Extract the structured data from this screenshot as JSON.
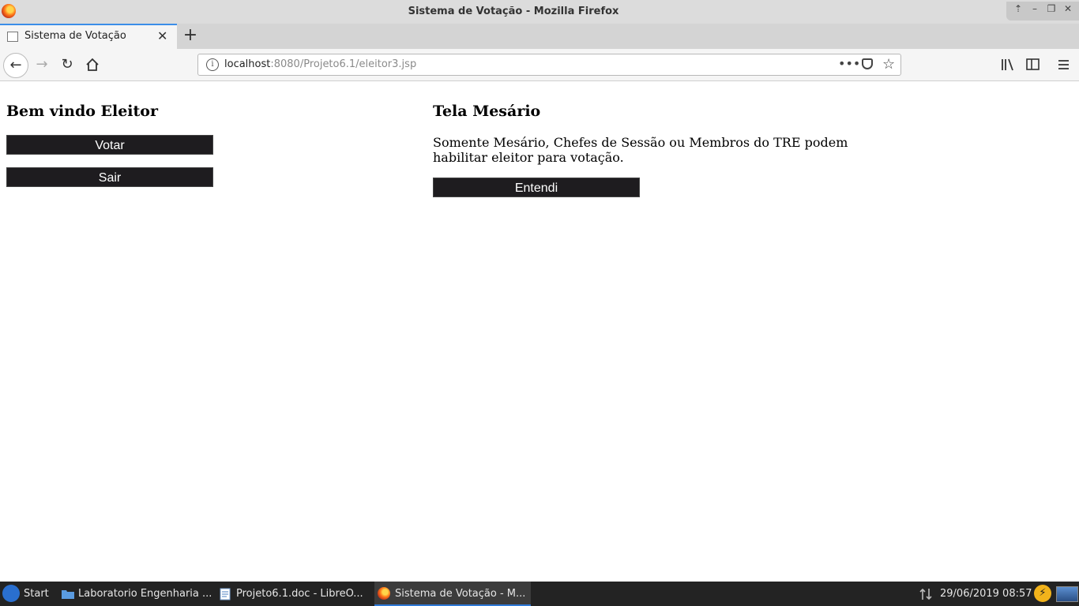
{
  "window": {
    "title": "Sistema de Votação - Mozilla Firefox"
  },
  "tab": {
    "label": "Sistema de Votação"
  },
  "url": {
    "host": "localhost",
    "rest": ":8080/Projeto6.1/eleitor3.jsp"
  },
  "left_panel": {
    "heading": "Bem vindo Eleitor",
    "vote_button": "Votar",
    "exit_button": "Sair"
  },
  "right_panel": {
    "heading": "Tela Mesário",
    "message": "Somente Mesário, Chefes de Sessão ou Membros do TRE podem habilitar eleitor para votação.",
    "ok_button": "Entendi"
  },
  "taskbar": {
    "start": "Start",
    "items": [
      "Laboratorio Engenharia ...",
      "Projeto6.1.doc - LibreO...",
      "Sistema de Votação - M..."
    ],
    "clock": "29/06/2019 08:57"
  }
}
